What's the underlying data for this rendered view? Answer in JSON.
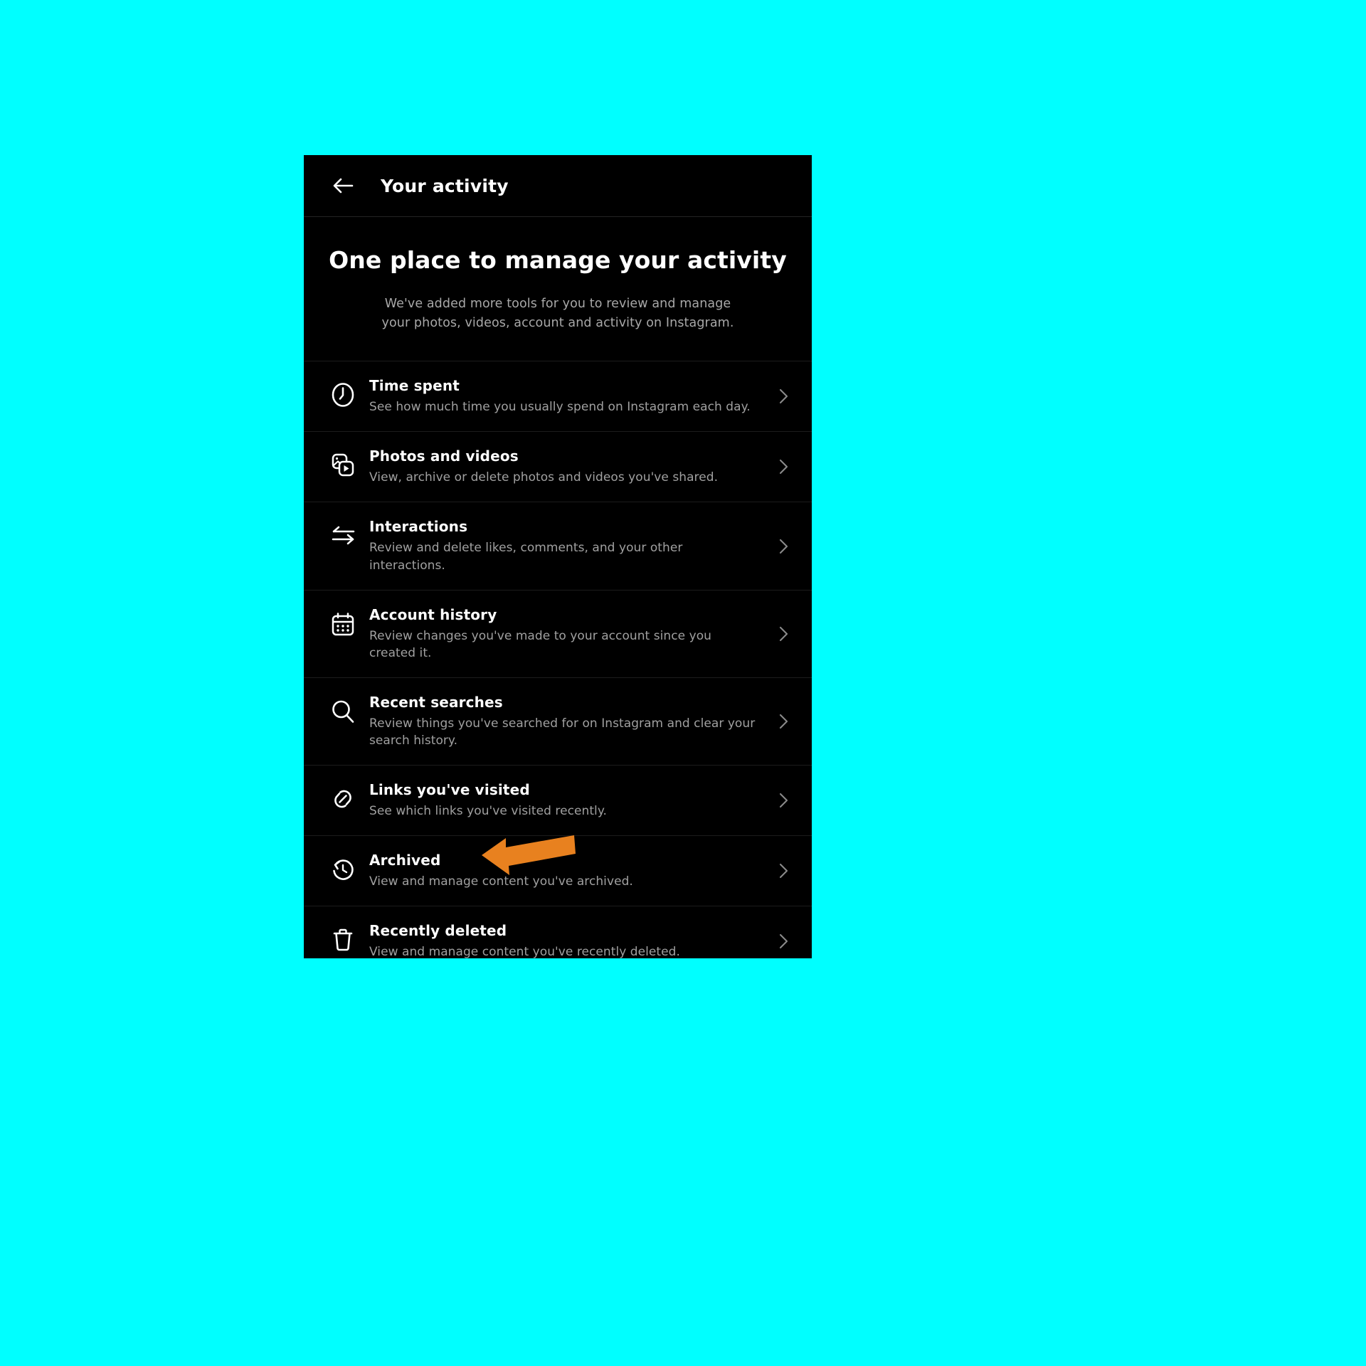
{
  "theme": {
    "page_background": "#00FFFF",
    "panel_background": "#000000",
    "primary_text": "#FFFFFF",
    "secondary_text": "#A8A8A8",
    "divider": "#1C1C1C",
    "annotation_accent": "#E8811F"
  },
  "topbar": {
    "back_icon": "arrow-left-icon",
    "title": "Your activity"
  },
  "hero": {
    "title": "One place to manage your activity",
    "subtitle": "We've added more tools for you to review and manage your photos, videos, account and activity on Instagram."
  },
  "list": {
    "chevron_icon": "chevron-right-icon",
    "items": [
      {
        "icon": "clock-icon",
        "title": "Time spent",
        "description": "See how much time you usually spend on Instagram each day."
      },
      {
        "icon": "photos-videos-icon",
        "title": "Photos and videos",
        "description": "View, archive or delete photos and videos you've shared."
      },
      {
        "icon": "interactions-arrows-icon",
        "title": "Interactions",
        "description": "Review and delete likes, comments, and your other interactions."
      },
      {
        "icon": "calendar-icon",
        "title": "Account history",
        "description": "Review changes you've made to your account since you created it."
      },
      {
        "icon": "search-icon",
        "title": "Recent searches",
        "description": "Review things you've searched for on Instagram and clear your search history."
      },
      {
        "icon": "link-icon",
        "title": "Links you've visited",
        "description": "See which links you've visited recently."
      },
      {
        "icon": "history-clock-icon",
        "title": "Archived",
        "description": "View and manage content you've archived."
      },
      {
        "icon": "trash-icon",
        "title": "Recently deleted",
        "description": "View and manage content you've recently deleted."
      }
    ]
  },
  "annotation": {
    "icon": "annotation-arrow-icon",
    "points_at": "Archived",
    "color": "#E8811F"
  }
}
